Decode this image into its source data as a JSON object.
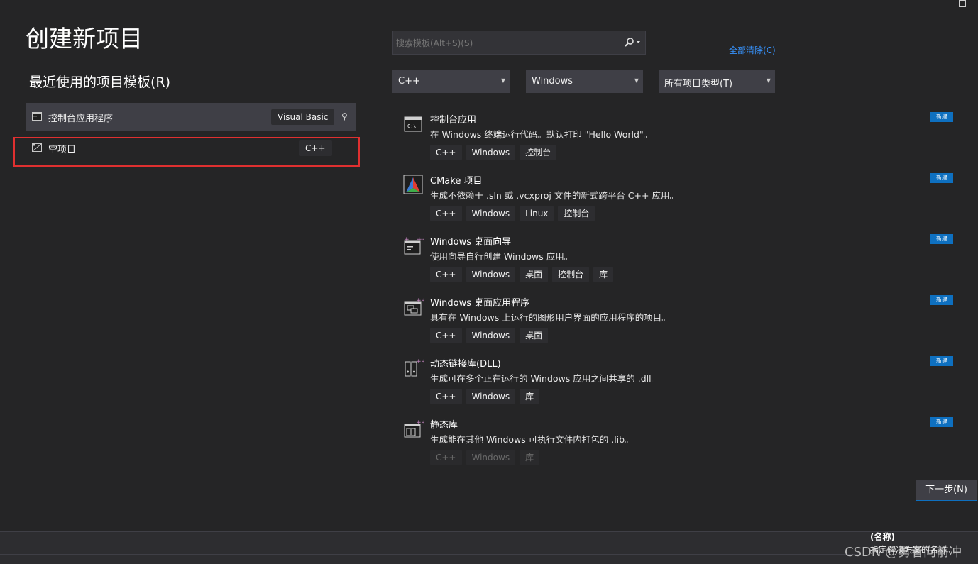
{
  "window": {
    "restore_icon": "restore-icon"
  },
  "page_title": "创建新项目",
  "recent": {
    "heading": "最近使用的项目模板(R)",
    "items": [
      {
        "label": "控制台应用程序",
        "tag": "Visual Basic",
        "icon": "console-app-icon",
        "pin_icon": "pin-icon"
      },
      {
        "label": "空项目",
        "tag": "C++",
        "icon": "empty-project-icon"
      }
    ]
  },
  "search": {
    "placeholder": "搜索模板(Alt+S)(S)",
    "icon": "search-icon"
  },
  "clear_all": "全部清除(C)",
  "filters": {
    "language": "C++",
    "platform": "Windows",
    "project_type": "所有项目类型(T)"
  },
  "templates": [
    {
      "name": "控制台应用",
      "desc": "在 Windows 终端运行代码。默认打印 \"Hello World\"。",
      "tags": [
        "C++",
        "Windows",
        "控制台"
      ],
      "badge": "新建",
      "icon": "console-icon"
    },
    {
      "name": "CMake 项目",
      "desc": "生成不依赖于 .sln 或 .vcxproj 文件的新式跨平台 C++ 应用。",
      "tags": [
        "C++",
        "Windows",
        "Linux",
        "控制台"
      ],
      "badge": "新建",
      "icon": "cmake-icon"
    },
    {
      "name": "Windows 桌面向导",
      "desc": "使用向导自行创建 Windows 应用。",
      "tags": [
        "C++",
        "Windows",
        "桌面",
        "控制台",
        "库"
      ],
      "badge": "新建",
      "icon": "desktop-wizard-icon"
    },
    {
      "name": "Windows 桌面应用程序",
      "desc": "具有在 Windows 上运行的图形用户界面的应用程序的项目。",
      "tags": [
        "C++",
        "Windows",
        "桌面"
      ],
      "badge": "新建",
      "icon": "desktop-app-icon"
    },
    {
      "name": "动态链接库(DLL)",
      "desc": "生成可在多个正在运行的 Windows 应用之间共享的 .dll。",
      "tags": [
        "C++",
        "Windows",
        "库"
      ],
      "badge": "新建",
      "icon": "dll-icon"
    },
    {
      "name": "静态库",
      "desc": "生成能在其他 Windows 可执行文件内打包的 .lib。",
      "tags": [
        "C++",
        "Windows",
        "库"
      ],
      "badge": "新建",
      "icon": "static-lib-icon"
    }
  ],
  "next_button": "下一步(N)",
  "bottom": {
    "name_label": "(名称)",
    "hint": "指定解决方案的名称。"
  },
  "watermark": "CSDN @勇者向前冲",
  "colors": {
    "background": "#252526",
    "accent": "#0e70c0",
    "link": "#3794ff",
    "highlight_box": "#e03030",
    "selected_row": "#3f3f46"
  }
}
